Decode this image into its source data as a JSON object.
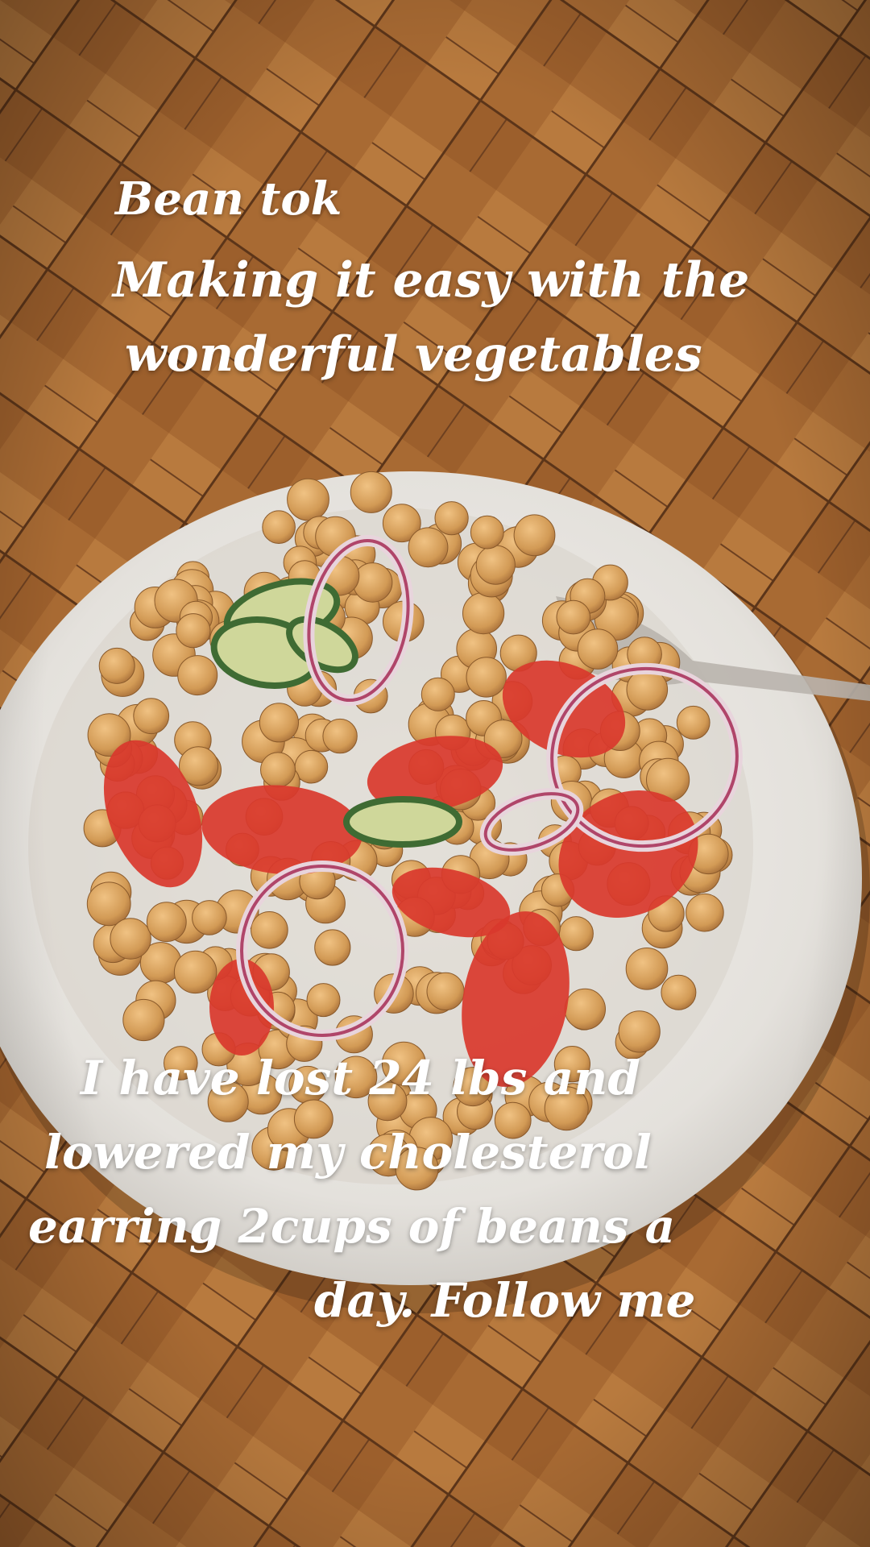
{
  "overlay": {
    "title": "Bean tok",
    "subtitle_line1": "Making it easy with the",
    "subtitle_line2": "wonderful vegetables",
    "bottom_line1": "I have lost 24 lbs and",
    "bottom_line2": "lowered my cholesterol",
    "bottom_line3": "earring 2cups of beans a",
    "bottom_line4": "day. Follow me"
  },
  "colors": {
    "text": "#ffffff",
    "wood": "#a86a33",
    "bowl": "#e9e7e3",
    "chickpea": "#d8a35f",
    "tomato": "#d9382c",
    "onion": "#b0456a",
    "cucumber": "#3f6b33"
  }
}
